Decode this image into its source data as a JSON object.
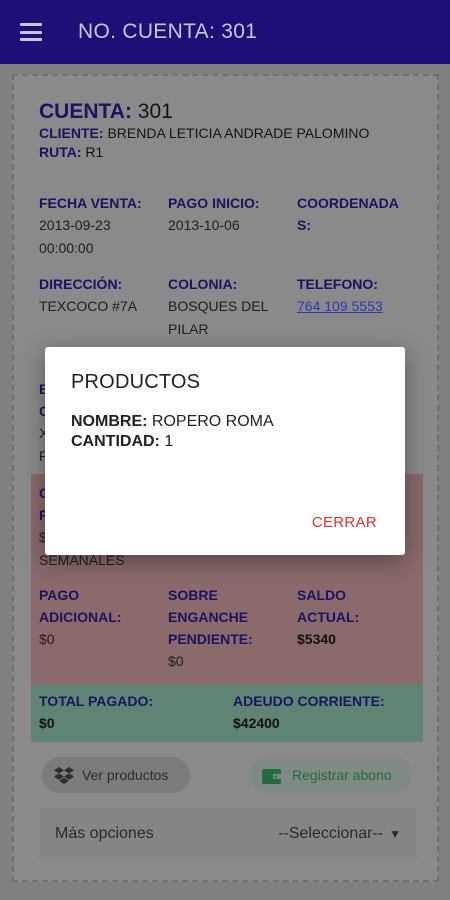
{
  "appbar": {
    "title": "NO. CUENTA: 301"
  },
  "account": {
    "cuenta_label": "CUENTA:",
    "cuenta_value": "301",
    "cliente_label": "CLIENTE:",
    "cliente_value": "BRENDA LETICIA ANDRADE PALOMINO",
    "ruta_label": "RUTA:",
    "ruta_value": "R1"
  },
  "fields": {
    "fecha_venta_label": "FECHA VENTA:",
    "fecha_venta_value_1": "2013-09-23",
    "fecha_venta_value_2": "00:00:00",
    "pago_inicio_label": "PAGO INICIO:",
    "pago_inicio_value": "2013-10-06",
    "coordenadas_label_1": "COORDENADA",
    "coordenadas_label_2": "S:",
    "direccion_label": "DIRECCIÓN:",
    "direccion_value": "TEXCOCO #7A",
    "colonia_label": "COLONIA:",
    "colonia_value_1": "BOSQUES DEL",
    "colonia_value_2": "PILAR",
    "telefono_label": "TELEFONO:",
    "telefono_value": "764 109 5553",
    "partial_b": "E",
    "partial_c": "C",
    "partial_x": "X",
    "partial_p": "P",
    "partial_c2": "C",
    "partial_p2": "P",
    "partial_s": "$",
    "semanales": "SEMANALES",
    "pago_adicional_label_1": "PAGO",
    "pago_adicional_label_2": "ADICIONAL:",
    "pago_adicional_value": "$0",
    "sobre_label_1": "SOBRE",
    "sobre_label_2": "ENGANCHE",
    "sobre_label_3": "PENDIENTE:",
    "sobre_value": "$0",
    "saldo_label_1": "SALDO",
    "saldo_label_2": "ACTUAL:",
    "saldo_value": "$5340",
    "total_pagado_label": "TOTAL PAGADO:",
    "total_pagado_value": "$0",
    "adeudo_label": "ADEUDO CORRIENTE:",
    "adeudo_value": "$42400"
  },
  "actions": {
    "ver_productos": "Ver productos",
    "registrar_abono": "Registrar abono",
    "mas_opciones": "Más opciones",
    "select_value": "--Seleccionar--"
  },
  "dialog": {
    "title": "PRODUCTOS",
    "nombre_label": "NOMBRE:",
    "nombre_value": "ROPERO ROMA",
    "cantidad_label": "CANTIDAD:",
    "cantidad_value": "1",
    "close_label": "CERRAR"
  },
  "colors": {
    "appbar": "#1b0f78",
    "label": "#1b1464",
    "red_section": "#f2b8bb",
    "green_section": "#b5e6d4",
    "close": "#ea2b2b"
  }
}
